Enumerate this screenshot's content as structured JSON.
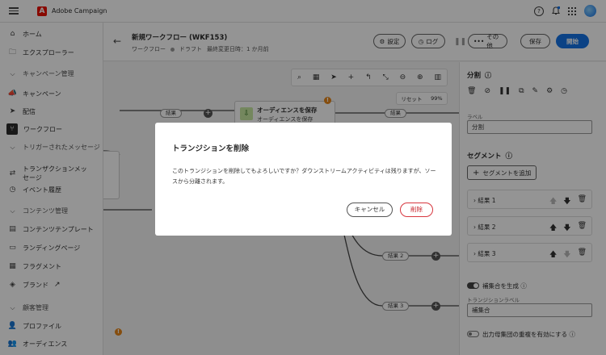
{
  "app": {
    "name": "Adobe Campaign"
  },
  "nav": {
    "home": "ホーム",
    "explorer": "エクスプローラー",
    "campaign_mgmt": "キャンペーン管理",
    "campaigns": "キャンペーン",
    "deliveries": "配信",
    "workflows": "ワークフロー",
    "triggered_msgs": "トリガーされたメッセージ",
    "transactional_msgs": "トランザクションメッセージ",
    "event_history": "イベント履歴",
    "content_mgmt": "コンテンツ管理",
    "content_templates": "コンテンツテンプレート",
    "landing_pages": "ランディングページ",
    "fragments": "フラグメント",
    "brands": "ブランド",
    "customer_mgmt": "顧客管理",
    "profiles": "プロファイル",
    "audiences": "オーディエンス"
  },
  "header": {
    "title": "新規ワークフロー (WKF153)",
    "type": "ワークフロー",
    "status": "ドラフト",
    "last_modified": "最終変更日時：1 か月前",
    "settings": "設定",
    "log": "ログ",
    "other": "その他",
    "save": "保存",
    "start": "開始"
  },
  "canvas": {
    "reset": "リセット",
    "zoom": "99%",
    "result": "結果",
    "result2": "結果 2",
    "result3": "結果 3",
    "node_title": "オーディエンスを保存",
    "node_sub": "オーディエンスを保存"
  },
  "panel": {
    "title": "分割",
    "label_caption": "ラベル",
    "label_value": "分割",
    "segments_title": "セグメント",
    "add_segment": "セグメントを追加",
    "segments": [
      {
        "label": "結果 1"
      },
      {
        "label": "結果 2"
      },
      {
        "label": "結果 3"
      }
    ],
    "complement_toggle": "補集合を生成",
    "transition_label_caption": "トランジションラベル",
    "transition_label_value": "補集合",
    "overlap_toggle": "出力母集団の重複を有効にする"
  },
  "modal": {
    "title": "トランジションを削除",
    "body": "このトランジションを削除してもよろしいですか？ダウンストリームアクティビティは残りますが、ソースから分離されます。",
    "cancel": "キャンセル",
    "delete": "削除"
  },
  "colors": {
    "accent": "#1473e6",
    "danger": "#d7373f",
    "adobe_red": "#eb1000"
  }
}
